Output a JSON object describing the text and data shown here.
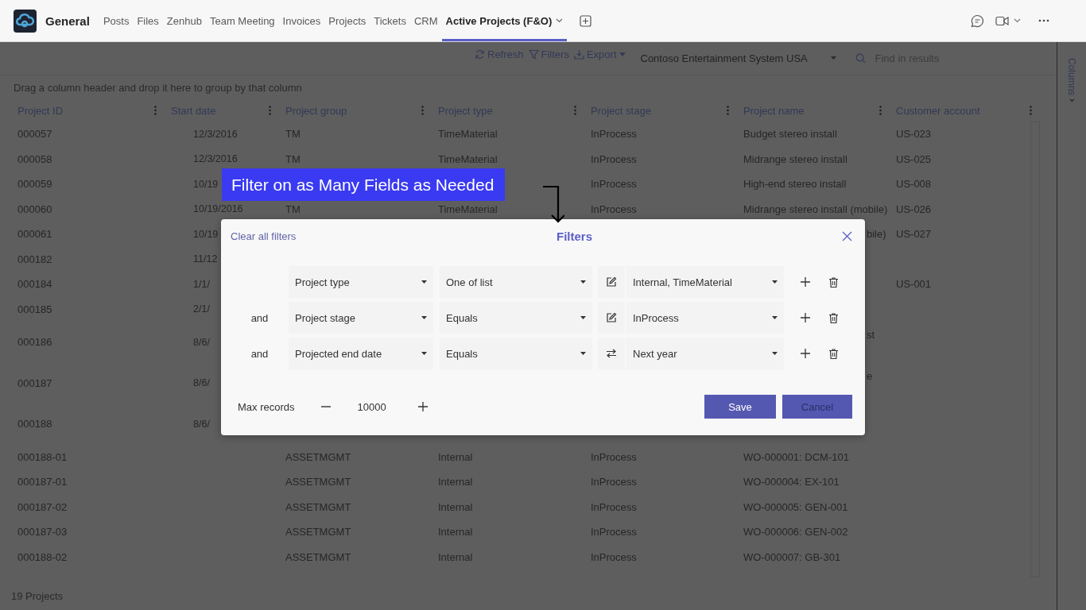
{
  "header": {
    "team": "General",
    "tabs": [
      {
        "label": "Posts",
        "selected": false
      },
      {
        "label": "Files",
        "selected": false
      },
      {
        "label": "Zenhub",
        "selected": false
      },
      {
        "label": "Team Meeting",
        "selected": false
      },
      {
        "label": "Invoices",
        "selected": false
      },
      {
        "label": "Projects",
        "selected": false
      },
      {
        "label": "Tickets",
        "selected": false
      },
      {
        "label": "CRM",
        "selected": false
      },
      {
        "label": "Active Projects (F&O)",
        "selected": true
      }
    ]
  },
  "toolbar": {
    "actions": [
      {
        "label": "Refresh",
        "kind": "refresh"
      },
      {
        "label": "Filters",
        "kind": "filter"
      },
      {
        "label": "Export",
        "kind": "export"
      }
    ],
    "company": "Contoso Entertainment System USA",
    "search": {
      "placeholder": "Find in results"
    }
  },
  "group_hint": "Drag a column header and drop it here to group by that column",
  "table": {
    "columns": [
      "Project ID",
      "Start date",
      "Project group",
      "Project type",
      "Project stage",
      "Project name",
      "Customer account"
    ],
    "rows": [
      {
        "kind": "full",
        "id": "000057",
        "start_date": "12/3/2016",
        "group": "TM",
        "type": "TimeMaterial",
        "stage": "InProcess",
        "name": "Budget stereo install",
        "customer": "US-023"
      },
      {
        "kind": "full",
        "id": "000058",
        "start_date": "12/3/2016",
        "group": "TM",
        "type": "TimeMaterial",
        "stage": "InProcess",
        "name": "Midrange stereo install",
        "customer": "US-025"
      },
      {
        "kind": "full",
        "id": "000059",
        "start_date": "10/19",
        "stage": "InProcess",
        "name": "High-end stereo install",
        "customer": "US-008"
      },
      {
        "kind": "full",
        "id": "000060",
        "start_date": "10/19/2016",
        "group": "TM",
        "type": "TimeMaterial",
        "stage": "InProcess",
        "name": "Midrange stereo install (mobile)",
        "customer": "US-026"
      },
      {
        "kind": "covered",
        "tall": false,
        "id": "000061",
        "start_date": "10/19",
        "name": "bile)",
        "customer": "US-027"
      },
      {
        "kind": "covered",
        "tall": false,
        "id": "000182",
        "start_date": "11/12"
      },
      {
        "kind": "covered",
        "tall": false,
        "id": "000184",
        "start_date": "1/1/",
        "customer": "US-001"
      },
      {
        "kind": "covered",
        "tall": false,
        "id": "000185",
        "start_date": "2/1/"
      },
      {
        "kind": "covered",
        "tall": true,
        "id": "000186",
        "start_date": "8/6/",
        "name": "st"
      },
      {
        "kind": "covered",
        "tall": true,
        "id": "000187",
        "start_date": "8/6/",
        "name": "e"
      },
      {
        "kind": "covered",
        "tall": true,
        "id": "000188",
        "start_date": "8/6/"
      },
      {
        "kind": "full",
        "id": "000188-01",
        "group": "ASSETMGMT",
        "type": "Internal",
        "stage": "InProcess",
        "name": "WO-000001: DCM-101"
      },
      {
        "kind": "full",
        "id": "000187-01",
        "group": "ASSETMGMT",
        "type": "Internal",
        "stage": "InProcess",
        "name": "WO-000004: EX-101"
      },
      {
        "kind": "full",
        "id": "000187-02",
        "group": "ASSETMGMT",
        "type": "Internal",
        "stage": "InProcess",
        "name": "WO-000005: GEN-001"
      },
      {
        "kind": "full",
        "id": "000187-03",
        "group": "ASSETMGMT",
        "type": "Internal",
        "stage": "InProcess",
        "name": "WO-000006: GEN-002"
      },
      {
        "kind": "full",
        "id": "000188-02",
        "group": "ASSETMGMT",
        "type": "Internal",
        "stage": "InProcess",
        "name": "WO-000007: GB-301"
      }
    ]
  },
  "status_bar": "19 Projects",
  "side_panel": {
    "label": "Columns"
  },
  "callout": "Filter on as Many Fields as Needed",
  "dialog": {
    "title": "Filters",
    "clear_label": "Clear all filters",
    "filters": [
      {
        "field": "Project type",
        "operator": "One of list",
        "kind": "manual",
        "value": "Internal, TimeMaterial"
      },
      {
        "connector": "and",
        "field": "Project stage",
        "operator": "Equals",
        "kind": "manual",
        "value": "InProcess"
      },
      {
        "connector": "and",
        "field": "Projected end date",
        "operator": "Equals",
        "kind": "relative",
        "value": "Next year"
      }
    ],
    "max_records": {
      "label": "Max records",
      "value": "10000"
    },
    "buttons": [
      {
        "label": "Save",
        "primary": true
      },
      {
        "label": "Cancel",
        "primary": false
      }
    ]
  }
}
